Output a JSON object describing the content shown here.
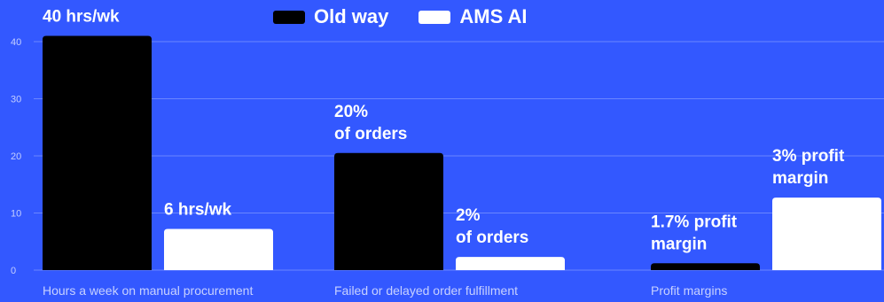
{
  "legend": [
    {
      "label": "Old way",
      "color": "#000000"
    },
    {
      "label": "AMS AI",
      "color": "#FFFFFF"
    }
  ],
  "chart_data": {
    "type": "bar",
    "title": "",
    "xlabel": "",
    "ylabel": "",
    "ylim": [
      0,
      40
    ],
    "yticks": [
      0,
      10,
      20,
      30,
      40
    ],
    "grid": true,
    "legend_position": "top-center",
    "categories": [
      "Hours a week on manual procurement",
      "Failed or delayed order fulfillment",
      "Profit margins"
    ],
    "series": [
      {
        "name": "Old way",
        "color": "#000000",
        "values": [
          41,
          20.5,
          1.2
        ],
        "labels": [
          [
            "40 hrs/wk"
          ],
          [
            "20%",
            "of orders"
          ],
          [
            "1.7% profit",
            "margin"
          ]
        ]
      },
      {
        "name": "AMS AI",
        "color": "#FFFFFF",
        "values": [
          7.2,
          2.3,
          12.7
        ],
        "labels": [
          [
            "6 hrs/wk"
          ],
          [
            "2%",
            "of orders"
          ],
          [
            "3% profit",
            "margin"
          ]
        ]
      }
    ]
  }
}
